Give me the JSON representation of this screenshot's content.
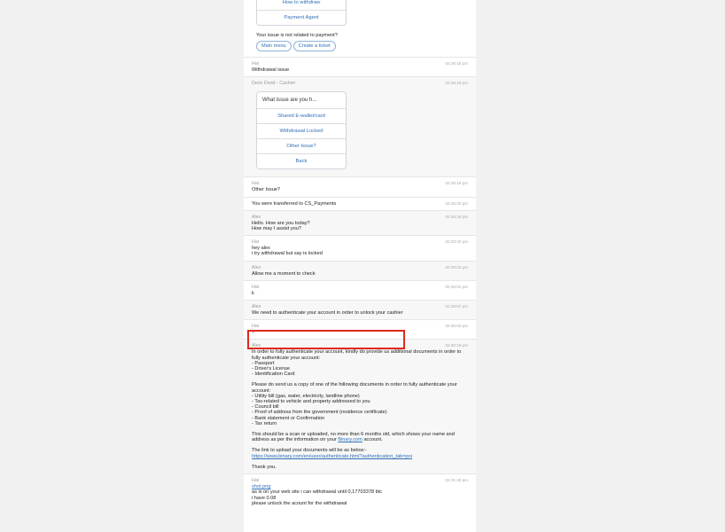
{
  "top_card": {
    "buttons": [
      "How to withdraw",
      "Payment Agent"
    ]
  },
  "not_related": {
    "prompt": "Your issue is not related to payment?",
    "buttons": [
      "Main menu",
      "Create a ticket"
    ]
  },
  "m1": {
    "sender": "Hai",
    "time": "02:26:15 pm",
    "lines": [
      "Withdrawal issue"
    ]
  },
  "bot_card": {
    "sender": "Deriv Droid - Cashier",
    "time": "02:26:15 pm",
    "title": "What issue are you h...",
    "options": [
      "Shared E-wallet/card",
      "Withdrawal Locked",
      "Other Issue?",
      "Back"
    ]
  },
  "m2": {
    "sender": "Hai",
    "time": "02:26:19 pm",
    "lines": [
      "Other Issue?"
    ]
  },
  "m3": {
    "time": "02:26:20 pm",
    "lines": [
      "You were transferred to CS_Payments"
    ]
  },
  "m4": {
    "sender": "Alex",
    "time": "02:28:38 pm",
    "lines": [
      "Hello. How are you today?",
      "How may I assist you?"
    ]
  },
  "m5": {
    "sender": "Hai",
    "time": "02:28:40 pm",
    "lines": [
      "hey alex",
      "i try withdrawal but say is locked"
    ]
  },
  "m6": {
    "sender": "Alex",
    "time": "02:29:03 pm",
    "lines": [
      "Allow me a moment to check"
    ]
  },
  "m7": {
    "sender": "Hai",
    "time": "02:29:01 pm",
    "lines": [
      "k"
    ]
  },
  "m8": {
    "sender": "Alex",
    "time": "02:29:57 pm",
    "lines": [
      "We need to authenticate your account in order to unlock your cashier"
    ]
  },
  "m9": {
    "sender": "Hai",
    "time": "02:30:04 pm",
    "lines": [
      "?"
    ]
  },
  "m10": {
    "sender": "Alex",
    "time": "02:30:19 pm",
    "p1": "In order to fully authenticate your account, kindly do provide us additional documents in order to fully authenticate your account:",
    "p1_items": [
      "- Passport",
      "- Driver's License",
      "- Identification Card"
    ],
    "p2": "Please do send us a copy of one of the following documents in order to fully authenticate your account:",
    "p2_items": [
      "- Utility bill (gas, water, electricity, landline phone)",
      "- Tax-related to vehicle and property addressed to you",
      "- Council bill",
      "- Proof of address from the government (residence certificate)",
      "- Bank statement or Confirmation",
      "- Tax return"
    ],
    "p3_pre": "This should be a scan or uploaded, no more than 6 months old, which shows your name and address as per the information on your ",
    "p3_link": "Binary.com",
    "p3_post": " account.",
    "p4": "The link to upload your documents will be as below:-",
    "p4_link": "https://www.binary.com/en/user/authenticate.html?authentication_tab=poi",
    "p5": "Thank you."
  },
  "m11": {
    "sender": "Hai",
    "time": "02:31:26 pm",
    "file": "shot.png",
    "lines": [
      "as is on your web site i can withdrawal until 0,17703378 btc",
      "i have 0.08",
      "please unlock the acount for the withdrawal"
    ]
  }
}
